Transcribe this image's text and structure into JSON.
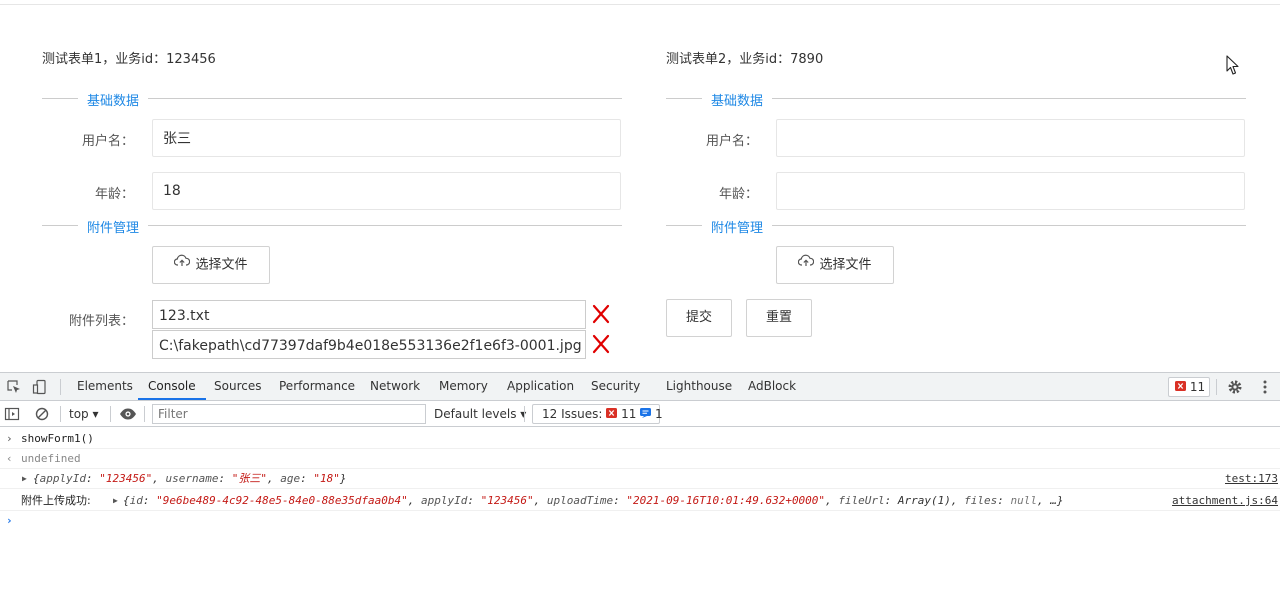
{
  "form1": {
    "title": "测试表单1，业务id：123456",
    "section_basic": "基础数据",
    "username_label": "用户名：",
    "username_value": "张三",
    "age_label": "年龄：",
    "age_value": "18",
    "section_attach": "附件管理",
    "choose_file_label": "选择文件",
    "attach_list_label": "附件列表：",
    "files": [
      "123.txt",
      "C:\\fakepath\\cd77397daf9b4e018e553136e2f1e6f3-0001.jpg"
    ]
  },
  "form2": {
    "title": "测试表单2，业务id：7890",
    "section_basic": "基础数据",
    "username_label": "用户名：",
    "username_value": "",
    "age_label": "年龄：",
    "age_value": "",
    "section_attach": "附件管理",
    "choose_file_label": "选择文件",
    "submit_label": "提交",
    "reset_label": "重置"
  },
  "devtools": {
    "tabs": [
      "Elements",
      "Console",
      "Sources",
      "Performance",
      "Network",
      "Memory",
      "Application",
      "Security",
      "Lighthouse",
      "AdBlock"
    ],
    "active_tab": "Console",
    "error_count": "11",
    "context": "top",
    "filter_placeholder": "Filter",
    "levels": "Default levels",
    "issues_label": "12 Issues:",
    "issues_errors": "11",
    "issues_info": "1",
    "console": {
      "cmd": "showForm1()",
      "result": "undefined",
      "log1": {
        "open": "{",
        "k1": "applyId",
        "v1": "\"123456\"",
        "k2": "username",
        "v2": "\"张三\"",
        "k3": "age",
        "v3": "\"18\"",
        "close": "}",
        "source": "test:173"
      },
      "log2": {
        "prefix": "附件上传成功:",
        "k1": "id",
        "v1": "\"9e6be489-4c92-48e5-84e0-88e35dfaa0b4\"",
        "k2": "applyId",
        "v2": "\"123456\"",
        "k3": "uploadTime",
        "v3": "\"2021-09-16T10:01:49.632+0000\"",
        "k4": "fileUrl",
        "v4": "Array(1)",
        "k5": "files",
        "v5": "null",
        "tail": ", …}",
        "source": "attachment.js:64"
      }
    }
  },
  "colors": {
    "accent": "#1e88e5",
    "delete_x": "#e00000",
    "devtools_active": "#1a73e8",
    "string_value": "#c41a16"
  },
  "icons": [
    "upload-cloud-icon",
    "delete-x-icon",
    "cursor-icon",
    "inspect-icon",
    "device-toggle-icon",
    "settings-gear-icon",
    "more-vertical-icon",
    "sidebar-toggle-icon",
    "clear-console-icon",
    "eye-icon",
    "error-icon",
    "info-icon"
  ]
}
